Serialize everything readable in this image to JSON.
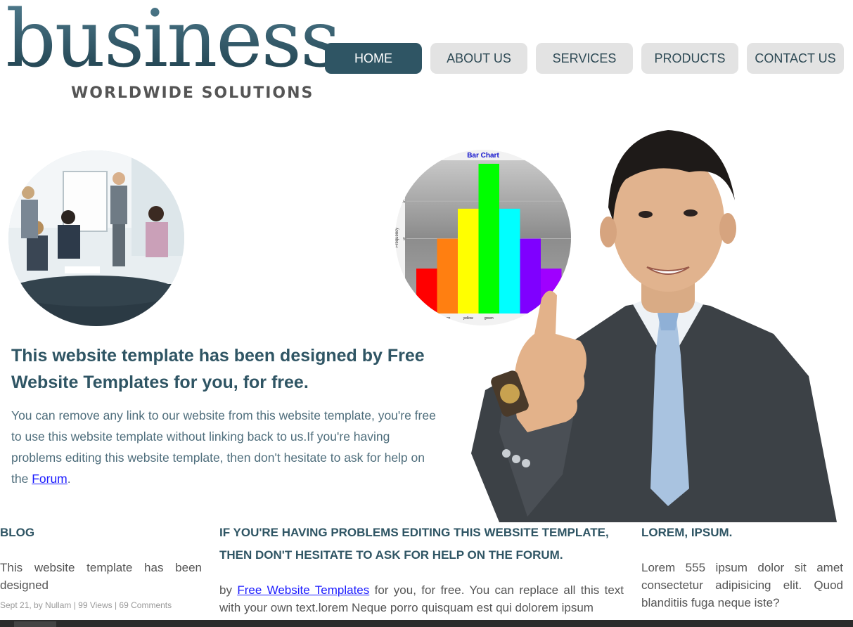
{
  "logo": {
    "word": "business",
    "tagline": "WORLDWIDE SOLUTIONS"
  },
  "nav": {
    "items": [
      {
        "label": "HOME",
        "active": true
      },
      {
        "label": "ABOUT US"
      },
      {
        "label": "SERVICES"
      },
      {
        "label": "PRODUCTS"
      },
      {
        "label": "CONTACT US"
      }
    ]
  },
  "hero": {
    "title": "This website template has been designed by Free Website Templates for you, for free.",
    "body_before": "You can remove any link to our website from this website template, you're free to use this website template without linking back to us.If you're having problems editing this website template, then don't hesitate to ask for help on the ",
    "link": "Forum",
    "body_after": "."
  },
  "chart_data": {
    "type": "bar",
    "title": "Bar Chart",
    "ylabel": "Frequency",
    "categories": [
      "red",
      "orange",
      "yellow",
      "green",
      "cyan",
      "blue",
      "violet"
    ],
    "visible_tick_labels": [
      "nge",
      "yellow",
      "green",
      "blue"
    ],
    "values": [
      3,
      5,
      7,
      10,
      7,
      5,
      3
    ],
    "visible_y_ticks": [
      "7.5",
      "5"
    ],
    "ylim": [
      0,
      10
    ],
    "colors": [
      "#ff0000",
      "#ff7f11",
      "#ffff00",
      "#00ff00",
      "#00ffff",
      "#7f00ff",
      "#9f00ff"
    ]
  },
  "columns": {
    "blog": {
      "heading": "BLOG",
      "text": "This website template has been designed",
      "meta": "Sept 21, by Nullam | 99 Views | 69 Comments"
    },
    "middle": {
      "heading": "IF YOU'RE HAVING PROBLEMS EDITING THIS WEBSITE TEMPLATE, THEN DON'T HESITATE TO ASK FOR HELP ON THE FORUM.",
      "text_before": "by ",
      "link": "Free Website Templates",
      "text_after": " for you, for free. You can replace all this text with your own text.lorem Neque porro quisquam est qui dolorem ipsum"
    },
    "right": {
      "heading": "LOREM, IPSUM.",
      "text": "Lorem 555 ipsum dolor sit amet consectetur adipisicing elit. Quod blanditiis fuga neque iste?"
    }
  },
  "colors": {
    "brand": "#2f5564",
    "nav_inactive": "#e3e3e3",
    "link": "#1a1aff"
  }
}
